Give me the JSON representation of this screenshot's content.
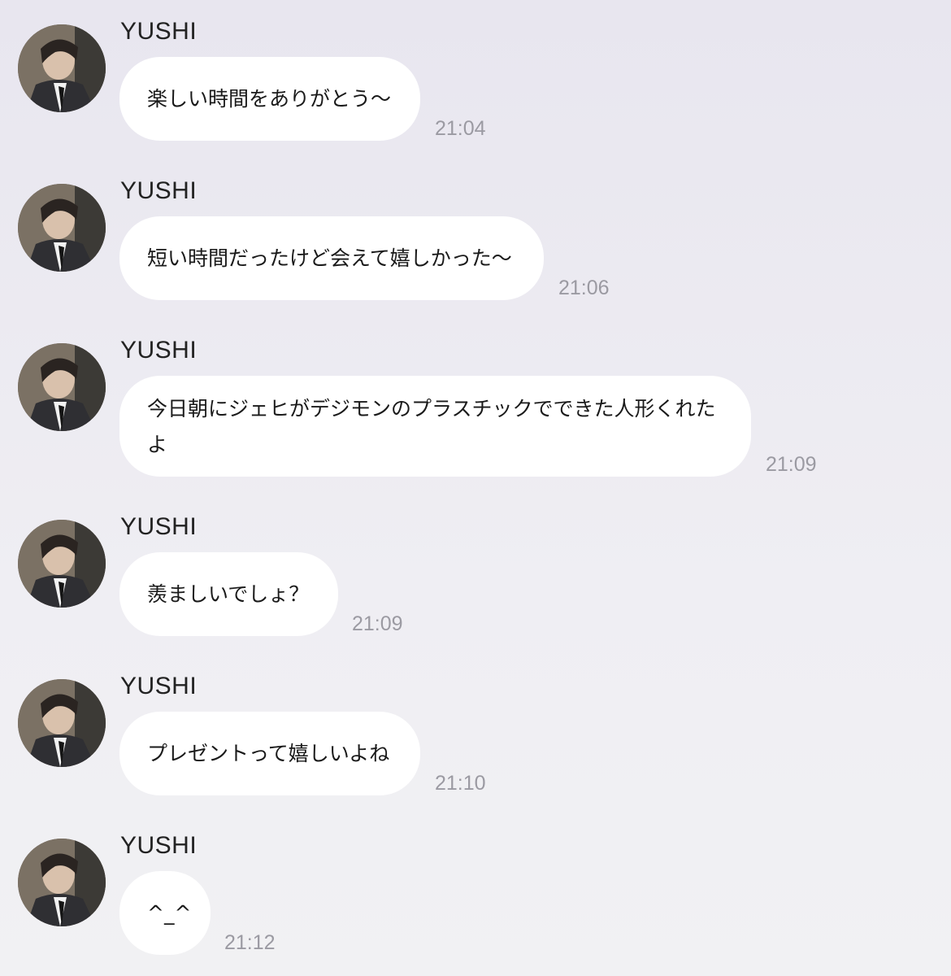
{
  "messages": [
    {
      "sender": "YUSHI",
      "text": "楽しい時間をありがとう〜",
      "time": "21:04"
    },
    {
      "sender": "YUSHI",
      "text": "短い時間だったけど会えて嬉しかった〜",
      "time": "21:06"
    },
    {
      "sender": "YUSHI",
      "text": "今日朝にジェヒがデジモンのプラスチックでできた人形くれたよ",
      "time": "21:09"
    },
    {
      "sender": "YUSHI",
      "text": "羨ましいでしょ？",
      "time": "21:09"
    },
    {
      "sender": "YUSHI",
      "text": "プレゼントって嬉しいよね",
      "time": "21:10"
    },
    {
      "sender": "YUSHI",
      "text": "^_^",
      "time": "21:12"
    }
  ],
  "colors": {
    "background": "#ebe9f0",
    "bubble": "#ffffff",
    "time_text": "#9b9aa2",
    "name_text": "#222222"
  },
  "icons": {
    "avatar": "profile-photo-avatar"
  }
}
